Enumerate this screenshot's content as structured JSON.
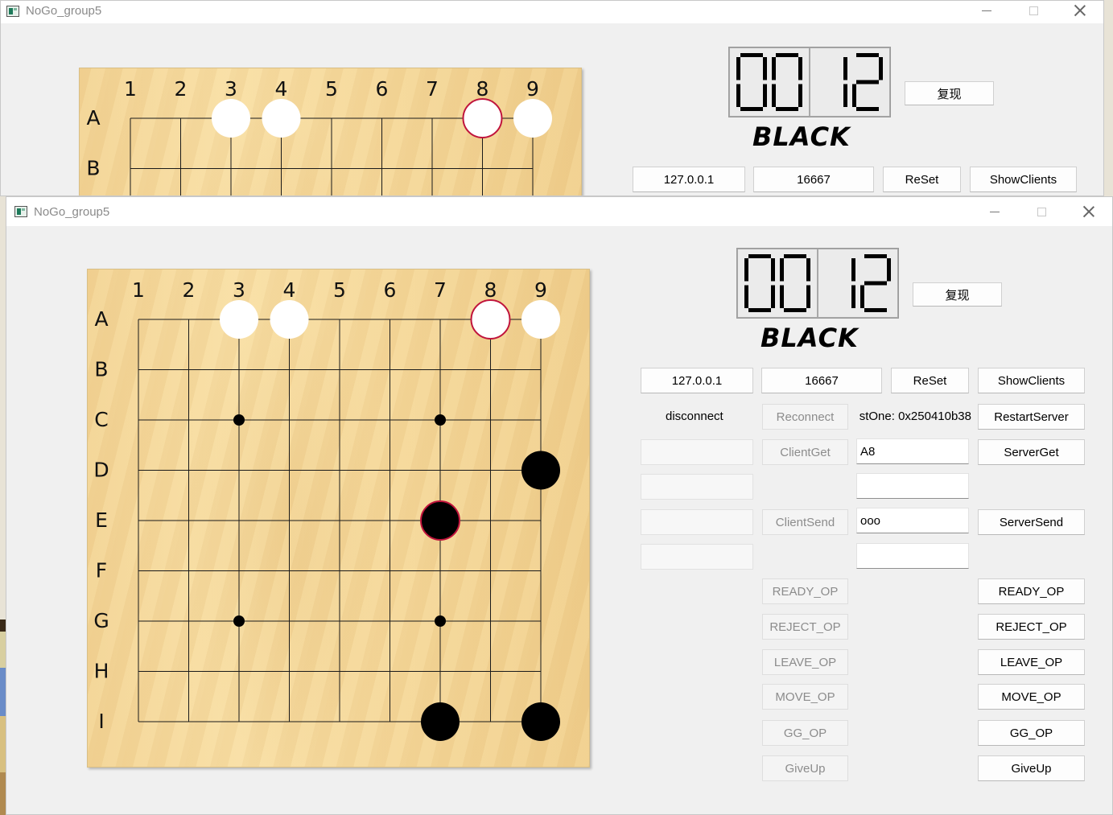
{
  "window_title": "NoGo_group5",
  "board": {
    "columns": [
      "1",
      "2",
      "3",
      "4",
      "5",
      "6",
      "7",
      "8",
      "9"
    ],
    "rows": [
      "A",
      "B",
      "C",
      "D",
      "E",
      "F",
      "G",
      "H",
      "I"
    ],
    "stones": [
      {
        "pos": "A3",
        "color": "white",
        "last": false
      },
      {
        "pos": "A4",
        "color": "white",
        "last": false
      },
      {
        "pos": "A8",
        "color": "white",
        "last": true
      },
      {
        "pos": "A9",
        "color": "white",
        "last": false
      },
      {
        "pos": "D9",
        "color": "black",
        "last": false
      },
      {
        "pos": "E7",
        "color": "black",
        "last": true
      },
      {
        "pos": "I7",
        "color": "black",
        "last": false
      },
      {
        "pos": "I9",
        "color": "black",
        "last": false
      }
    ],
    "star_points": [
      "C3",
      "C7",
      "G3",
      "G7"
    ]
  },
  "timer": {
    "minutes": "00",
    "seconds": "12"
  },
  "turn_label": "BLACK",
  "replay_button": "复现",
  "network": {
    "ip": "127.0.0.1",
    "port": "16667"
  },
  "buttons": {
    "reset": "ReSet",
    "show_clients": "ShowClients",
    "reconnect": "Reconnect",
    "restart_server": "RestartServer",
    "client_get": "ClientGet",
    "server_get": "ServerGet",
    "client_send": "ClientSend",
    "server_send": "ServerSend"
  },
  "connection_status": "disconnect",
  "first_client_label": "stOne: 0x250410b38",
  "server_get_value": "A8",
  "server_send_value": "ooo",
  "op_buttons": [
    "READY_OP",
    "REJECT_OP",
    "LEAVE_OP",
    "MOVE_OP",
    "GG_OP",
    "GiveUp"
  ],
  "colors": {
    "window_bg": "#f0f0f0",
    "board_wood": "#f5d89b",
    "last_move_ring": "#c0143c",
    "grid_line": "#1a1a1a"
  }
}
